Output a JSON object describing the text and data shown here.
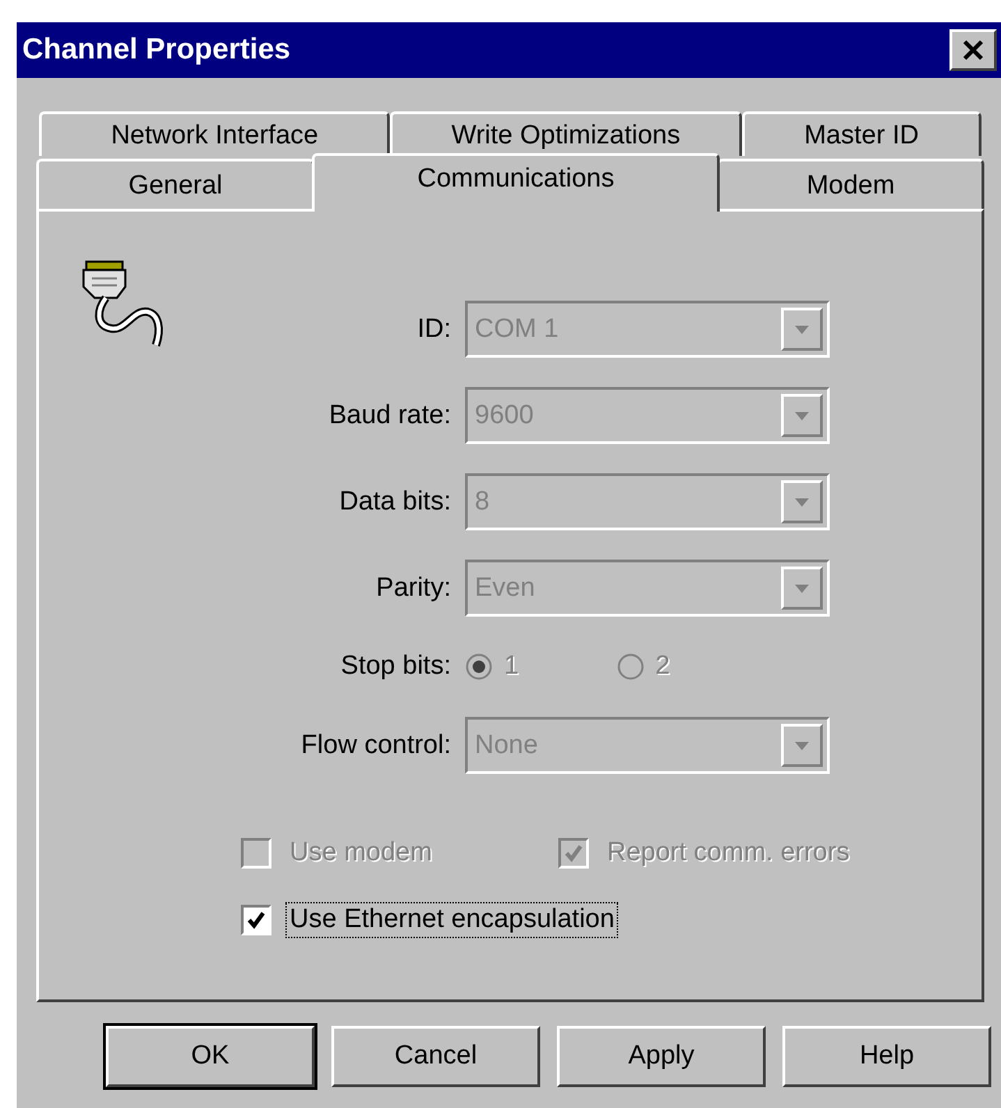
{
  "window": {
    "title": "Channel Properties"
  },
  "tab_rows": [
    {
      "tabs": [
        {
          "label": "Network Interface",
          "selected": false
        },
        {
          "label": "Write Optimizations",
          "selected": false
        },
        {
          "label": "Master ID",
          "selected": false
        }
      ]
    },
    {
      "tabs": [
        {
          "label": "General",
          "selected": false
        },
        {
          "label": "Communications",
          "selected": true
        },
        {
          "label": "Modem",
          "selected": false
        }
      ]
    }
  ],
  "fields": [
    {
      "kind": "dropdown",
      "label": "ID:",
      "value": "COM 1",
      "disabled": true
    },
    {
      "kind": "dropdown",
      "label": "Baud rate:",
      "value": "9600",
      "disabled": true
    },
    {
      "kind": "dropdown",
      "label": "Data bits:",
      "value": "8",
      "disabled": true
    },
    {
      "kind": "dropdown",
      "label": "Parity:",
      "value": "Even",
      "disabled": true
    },
    {
      "kind": "radio",
      "label": "Stop bits:",
      "disabled": true,
      "options": [
        {
          "label": "1",
          "selected": true
        },
        {
          "label": "2",
          "selected": false
        }
      ]
    },
    {
      "kind": "dropdown",
      "label": "Flow control:",
      "value": "None",
      "disabled": true
    }
  ],
  "checkboxes": [
    {
      "label": "Use modem",
      "checked": false,
      "disabled": true,
      "focused": false
    },
    {
      "label": "Report comm. errors",
      "checked": true,
      "disabled": true,
      "focused": false
    },
    {
      "label": "Use Ethernet encapsulation",
      "checked": true,
      "disabled": false,
      "focused": true
    }
  ],
  "buttons": [
    {
      "label": "OK",
      "default": true
    },
    {
      "label": "Cancel",
      "default": false
    },
    {
      "label": "Apply",
      "default": false
    },
    {
      "label": "Help",
      "default": false
    }
  ]
}
